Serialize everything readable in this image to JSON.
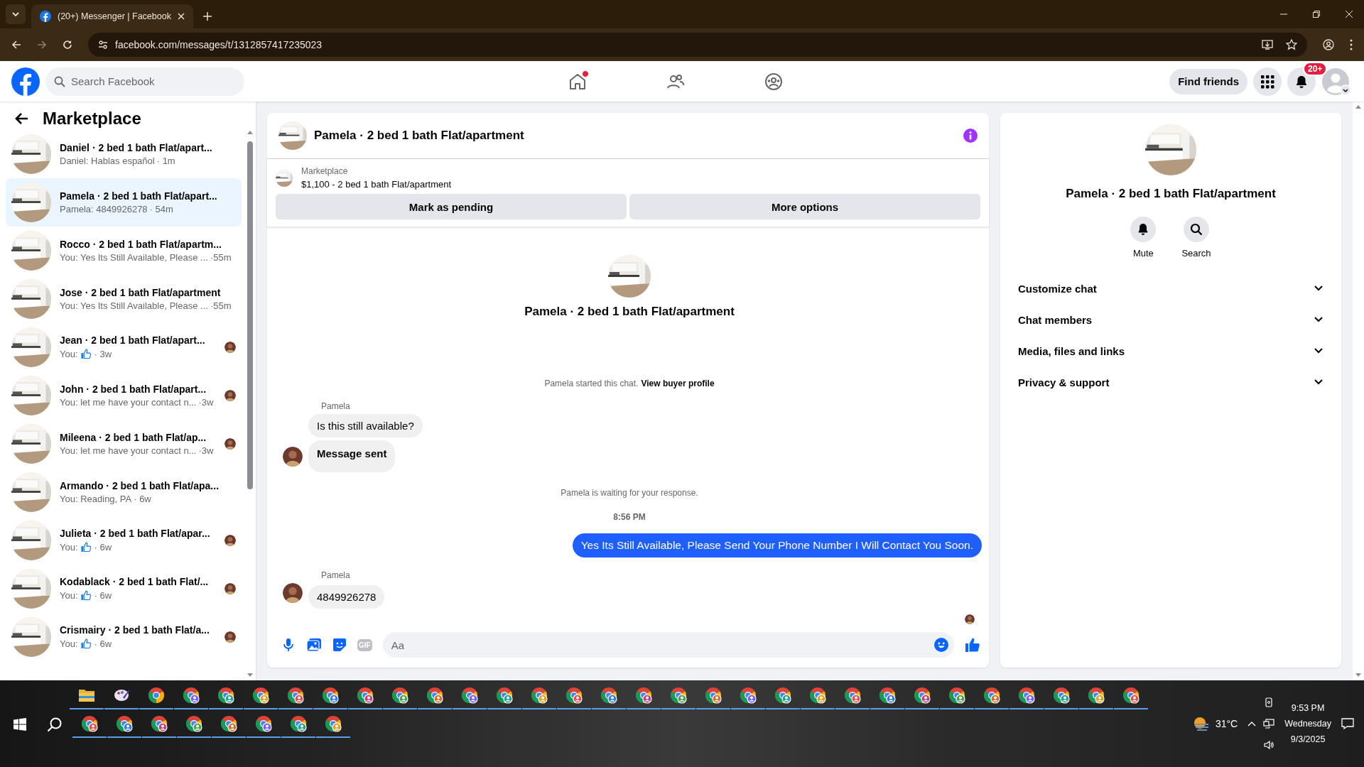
{
  "browser": {
    "tab_title": "(20+) Messenger | Facebook",
    "url": "facebook.com/messages/t/1312857417235023"
  },
  "header": {
    "search_placeholder": "Search Facebook",
    "nav": [
      {
        "kind": "home",
        "dot": true
      },
      {
        "kind": "friends",
        "dot": false
      },
      {
        "kind": "groups",
        "dot": false
      }
    ],
    "find_friends": "Find friends",
    "notification_badge": "20+"
  },
  "sidebar": {
    "title": "Marketplace",
    "conversations": [
      {
        "title": "Daniel · 2 bed 1 bath Flat/apart...",
        "preview": "Daniel: Hablas español",
        "like": false,
        "time": "· 1m",
        "seen": false,
        "selected": false
      },
      {
        "title": "Pamela · 2 bed 1 bath Flat/apart...",
        "preview": "Pamela: 4849926278",
        "like": false,
        "time": "· 54m",
        "seen": false,
        "selected": true
      },
      {
        "title": "Rocco · 2 bed 1 bath Flat/apartm...",
        "preview": "You: Yes Its Still Available, Please ...",
        "like": false,
        "time": "·55m",
        "seen": false,
        "selected": false
      },
      {
        "title": "Jose · 2 bed 1 bath Flat/apartment",
        "preview": "You: Yes Its Still Available, Please ...",
        "like": false,
        "time": "·55m",
        "seen": false,
        "selected": false
      },
      {
        "title": "Jean · 2 bed 1 bath Flat/apart...",
        "preview": "You:",
        "like": true,
        "time": "· 3w",
        "seen": true,
        "selected": false
      },
      {
        "title": "John · 2 bed 1 bath Flat/apart...",
        "preview": "You: let me have your contact n...",
        "like": false,
        "time": "·3w",
        "seen": true,
        "selected": false
      },
      {
        "title": "Mileena · 2 bed 1 bath Flat/ap...",
        "preview": "You: let me have your contact n...",
        "like": false,
        "time": "·3w",
        "seen": true,
        "selected": false
      },
      {
        "title": "Armando · 2 bed 1 bath Flat/apa...",
        "preview": "You: Reading, PA",
        "like": false,
        "time": "· 6w",
        "seen": false,
        "selected": false
      },
      {
        "title": "Julieta · 2 bed 1 bath Flat/apar...",
        "preview": "You:",
        "like": true,
        "time": "· 6w",
        "seen": true,
        "selected": false
      },
      {
        "title": "Kodablack · 2 bed 1 bath Flat/...",
        "preview": "You:",
        "like": true,
        "time": "· 6w",
        "seen": true,
        "selected": false
      },
      {
        "title": "Crismairy · 2 bed 1 bath Flat/a...",
        "preview": "You:",
        "like": true,
        "time": "· 6w",
        "seen": true,
        "selected": false
      }
    ]
  },
  "chat": {
    "title": "Pamela · 2 bed 1 bath Flat/apartment",
    "listing": {
      "label": "Marketplace",
      "title": "$1,100 - 2 bed 1 bath Flat/apartment"
    },
    "actions": [
      "Mark as pending",
      "More options"
    ],
    "intro_name": "Pamela · 2 bed 1 bath Flat/apartment",
    "thread": [
      {
        "kind": "notice",
        "text": "Pamela started this chat.",
        "link": "View buyer profile"
      },
      {
        "kind": "incoming",
        "sender": "Pamela",
        "messages": [
          {
            "text": "Is this still available?",
            "bold": false
          },
          {
            "text": "Message sent",
            "bold": true
          }
        ]
      },
      {
        "kind": "notice",
        "text": "Pamela is waiting for your response."
      },
      {
        "kind": "time",
        "text": "8:56 PM"
      },
      {
        "kind": "outgoing",
        "text": "Yes Its Still Available, Please Send Your Phone Number I Will Contact You Soon."
      },
      {
        "kind": "incoming",
        "sender": "Pamela",
        "messages": [
          {
            "text": "4849926278",
            "bold": false
          }
        ]
      },
      {
        "kind": "seen"
      }
    ],
    "composer": {
      "gif": "GIF",
      "placeholder": "Aa"
    }
  },
  "details": {
    "name": "Pamela · 2 bed 1 bath Flat/apartment",
    "actions": [
      {
        "kind": "mute",
        "label": "Mute"
      },
      {
        "kind": "search",
        "label": "Search"
      }
    ],
    "sections": [
      {
        "label": "Customize chat",
        "expanded": false
      },
      {
        "label": "Chat members",
        "expanded": false
      },
      {
        "label": "Media, files and links",
        "expanded": false
      },
      {
        "label": "Privacy & support",
        "expanded": false
      }
    ]
  },
  "taskbar": {
    "temperature": "31°C",
    "time": "9:53 PM",
    "day": "Wednesday",
    "date": "9/3/2025"
  }
}
